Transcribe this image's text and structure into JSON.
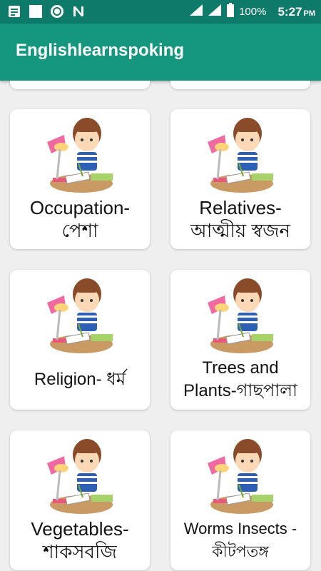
{
  "status_bar": {
    "battery_percent": "100%",
    "time": "5:27",
    "ampm": "PM"
  },
  "app_bar": {
    "title": "Englishlearnspoking"
  },
  "cards": [
    {
      "line1": "Occupation-",
      "line2": "পেশা"
    },
    {
      "line1": "Relatives-",
      "line2": "আত্মীয় স্বজন"
    },
    {
      "line1": "Religion- ধর্ম",
      "line2": ""
    },
    {
      "line1": "Trees and",
      "line2": "Plants-গাছপালা"
    },
    {
      "line1": "Vegetables-",
      "line2": "শাকসবজি"
    },
    {
      "line1": "Worms Insects -",
      "line2": "কীটপতঙ্গ"
    }
  ]
}
